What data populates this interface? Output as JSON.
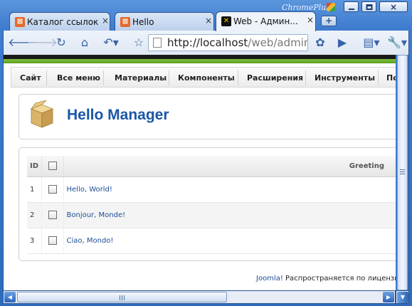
{
  "browser": {
    "brand": "ChromePlus",
    "tabs": [
      {
        "title": "Каталог ссылок",
        "favicon": "xampp-icon"
      },
      {
        "title": "Hello",
        "favicon": "xampp-icon"
      },
      {
        "title": "Web - Админ...",
        "favicon": "joomla-icon",
        "active": true
      }
    ],
    "close_glyph": "×",
    "new_tab_glyph": "+",
    "address": {
      "host": "http://localhost",
      "rest": "/web/adminis"
    },
    "toolbar_icons": [
      "back-icon",
      "forward-icon",
      "reload-icon",
      "home-icon",
      "undo-icon",
      "star-icon",
      "page-icon",
      "extension-icon",
      "go-icon",
      "page-menu-icon",
      "wrench-icon"
    ]
  },
  "admin_menu": [
    "Сайт",
    "Все меню",
    "Материалы",
    "Компоненты",
    "Расширения",
    "Инструменты",
    "По"
  ],
  "page": {
    "title": "Hello Manager",
    "icon": "package-box-icon"
  },
  "table": {
    "columns": {
      "id": "ID",
      "greeting": "Greeting"
    },
    "rows": [
      {
        "id": "1",
        "greeting": "Hello, World!"
      },
      {
        "id": "2",
        "greeting": "Bonjour, Monde!"
      },
      {
        "id": "3",
        "greeting": "Ciao, Mondo!"
      }
    ]
  },
  "footer": {
    "joomla_link": "Joomla!",
    "text": "Распространяется по лицензии"
  },
  "colors": {
    "title_blue": "#1a57a6",
    "menu_green": "#6fb233",
    "chrome_blue": "#3f7ccf"
  }
}
